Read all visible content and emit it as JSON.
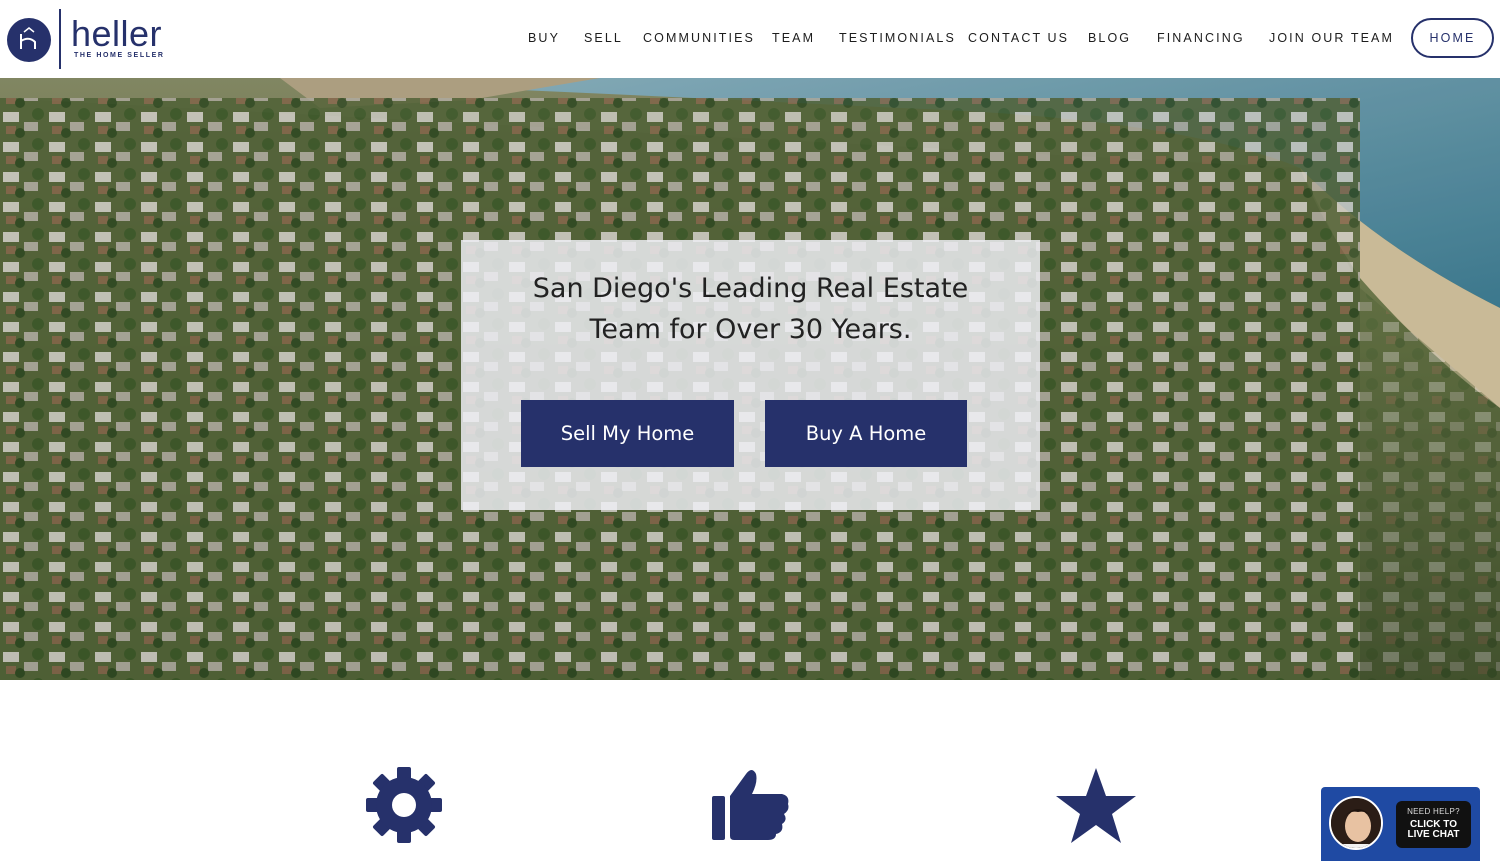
{
  "brand": {
    "name": "heller",
    "tagline": "THE HOME SELLER",
    "primary_color": "#26316b"
  },
  "nav": {
    "items": [
      "BUY",
      "SELL",
      "COMMUNITIES",
      "TEAM",
      "TESTIMONIALS",
      "CONTACT US",
      "BLOG",
      "FINANCING",
      "JOIN OUR TEAM"
    ],
    "active": "HOME"
  },
  "hero": {
    "title_line1": "San Diego's Leading Real Estate",
    "title_line2": "Team for Over 30 Years.",
    "sell_button": "Sell My Home",
    "buy_button": "Buy A Home"
  },
  "features": {
    "icons": [
      "gear-icon",
      "thumbs-up-icon",
      "star-icon"
    ]
  },
  "chat": {
    "question": "NEED HELP?",
    "cta_line1": "CLICK TO",
    "cta_line2": "LIVE CHAT"
  }
}
